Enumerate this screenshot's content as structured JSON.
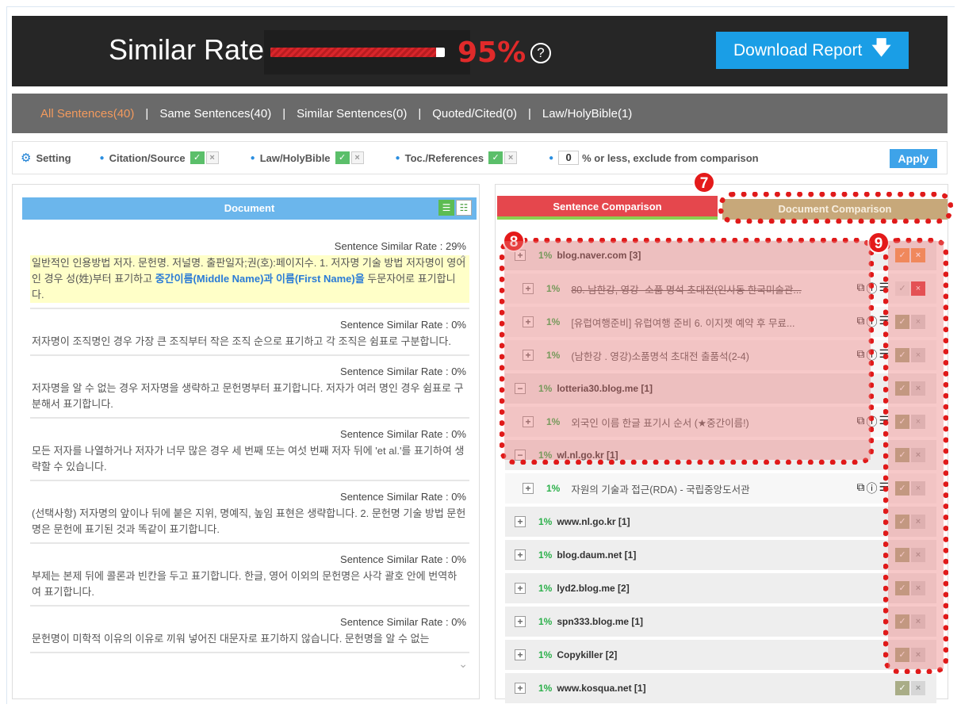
{
  "header": {
    "title": "Similar Rate",
    "similar_rate": "95%",
    "similar_rate_value": 0.95,
    "help_symbol": "?",
    "download_label": "Download Report"
  },
  "tabs": [
    {
      "label": "All Sentences(40)",
      "active": true
    },
    {
      "label": "Same Sentences(40)",
      "active": false
    },
    {
      "label": "Similar Sentences(0)",
      "active": false
    },
    {
      "label": "Quoted/Cited(0)",
      "active": false
    },
    {
      "label": "Law/HolyBible(1)",
      "active": false
    }
  ],
  "settings": {
    "label": "Setting",
    "options": [
      "Citation/Source",
      "Law/HolyBible",
      "Toc./References"
    ],
    "threshold_value": "0",
    "threshold_label": "% or less, exclude from comparison",
    "apply_label": "Apply"
  },
  "document": {
    "header": "Document",
    "sentences": [
      {
        "rate": "Sentence Similar Rate : 29%",
        "text_before": "일반적인 인용방법 저자. 문헌명. 저널명. 출판일자;권(호):페이지수. 1. 저자명 기술 방법 저자명이 영어인 경우 성(姓)부터 표기하고 ",
        "text_highlight": "중간이름(Middle Name)과 이름(First Name)을",
        "text_after": " 두문자어로 표기합니다.",
        "highlight": true
      },
      {
        "rate": "Sentence Similar Rate : 0%",
        "text": "저자명이 조직명인 경우 가장 큰 조직부터 작은 조직 순으로 표기하고 각 조직은 쉼표로 구분합니다."
      },
      {
        "rate": "Sentence Similar Rate : 0%",
        "text": "저자명을 알 수 없는 경우 저자명을 생략하고 문헌명부터 표기합니다. 저자가 여러 명인 경우 쉼표로 구분해서 표기합니다."
      },
      {
        "rate": "Sentence Similar Rate : 0%",
        "text": "모든 저자를 나열하거나 저자가 너무 많은 경우 세 번째 또는 여섯 번째 저자 뒤에 'et al.'를 표기하여 생략할 수 있습니다."
      },
      {
        "rate": "Sentence Similar Rate : 0%",
        "text": "(선택사항) 저자명의 앞이나 뒤에 붙은 지위, 명예직, 높임 표현은 생략합니다. 2. 문헌명 기술 방법 문헌명은 문헌에 표기된 것과 똑같이 표기합니다."
      },
      {
        "rate": "Sentence Similar Rate : 0%",
        "text": "부제는 본제 뒤에 콜론과 빈칸을 두고 표기합니다. 한글, 영어 이외의 문헌명은 사각 괄호 안에 번역하여 표기합니다."
      },
      {
        "rate": "Sentence Similar Rate : 0%",
        "text": "문헌명이 미학적 이유의 이유로 끼워 넣어진 대문자로 표기하지 않습니다. 문헌명을 알 수 없는"
      }
    ]
  },
  "comparison": {
    "tab_sentence": "Sentence Comparison",
    "tab_document": "Document Comparison",
    "badges": [
      "7",
      "8",
      "9"
    ],
    "rows": [
      {
        "kind": "group",
        "toggle": "+",
        "pct": "1%",
        "name": "blog.naver.com [3]",
        "acts": "orange"
      },
      {
        "kind": "sub",
        "toggle": "+",
        "pct": "1%",
        "name": "80. 남한강, 영강- 소품 명석 초대전(인사동 한국미술관...",
        "strike": true,
        "acts": "red"
      },
      {
        "kind": "sub",
        "toggle": "+",
        "pct": "1%",
        "name": "[유럽여행준비] 유럽여행 준비 6. 이지젯 예약 후 무료...",
        "acts": "normal"
      },
      {
        "kind": "sub",
        "toggle": "+",
        "pct": "1%",
        "name": "(남한강 . 영강)소품명석 초대전 출품석(2-4)",
        "acts": "normal"
      },
      {
        "kind": "group",
        "toggle": "−",
        "pct": "1%",
        "name": "lotteria30.blog.me [1]",
        "acts": "normal"
      },
      {
        "kind": "sub",
        "toggle": "+",
        "pct": "1%",
        "name": "외국인 이름 한글 표기시 순서 (★중간이름!)",
        "acts": "normal"
      },
      {
        "kind": "group",
        "toggle": "−",
        "pct": "1%",
        "name": "wl.nl.go.kr [1]",
        "acts": "normal"
      },
      {
        "kind": "sub",
        "toggle": "+",
        "pct": "1%",
        "name": "자원의 기술과 접근(RDA) - 국립중앙도서관",
        "acts": "normal"
      },
      {
        "kind": "group",
        "toggle": "+",
        "pct": "1%",
        "name": "www.nl.go.kr [1]",
        "acts": "normal"
      },
      {
        "kind": "group",
        "toggle": "+",
        "pct": "1%",
        "name": "blog.daum.net [1]",
        "acts": "normal"
      },
      {
        "kind": "group",
        "toggle": "+",
        "pct": "1%",
        "name": "lyd2.blog.me [2]",
        "acts": "normal"
      },
      {
        "kind": "group",
        "toggle": "+",
        "pct": "1%",
        "name": "spn333.blog.me [1]",
        "acts": "normal"
      },
      {
        "kind": "group",
        "toggle": "+",
        "pct": "1%",
        "name": "Copykiller [2]",
        "acts": "normal"
      },
      {
        "kind": "group",
        "toggle": "+",
        "pct": "1%",
        "name": "www.kosqua.net [1]",
        "acts": "normal"
      }
    ]
  },
  "icons": {
    "check": "✓",
    "cross": "×",
    "plus": "+",
    "minus": "−",
    "download": "arrow-down-icon",
    "setting": "gear-icon",
    "link": "external-link-icon",
    "info": "info-icon",
    "list": "list-icon"
  },
  "colors": {
    "accent_red": "#e02a2a",
    "download_blue": "#1a9ee6",
    "active_tab": "#f39a5d",
    "percent_green": "#2bb04a",
    "annotation_red": "#e01a1a"
  }
}
